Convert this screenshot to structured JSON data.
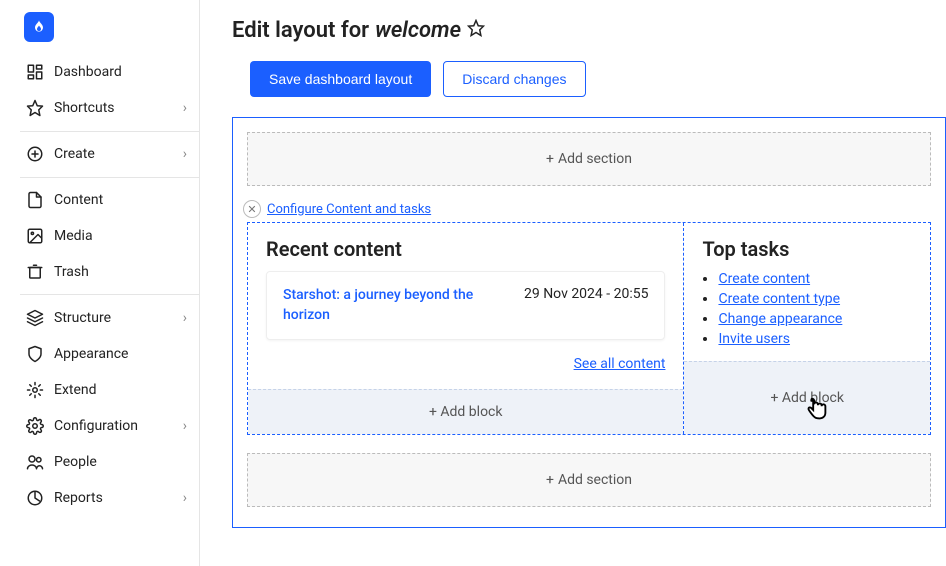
{
  "sidebar": {
    "items": [
      {
        "label": "Dashboard",
        "icon": "dashboard",
        "chevron": false
      },
      {
        "label": "Shortcuts",
        "icon": "star",
        "chevron": true,
        "divAfter": true
      },
      {
        "label": "Create",
        "icon": "plus-circle",
        "chevron": true,
        "divAfter": true
      },
      {
        "label": "Content",
        "icon": "file",
        "chevron": false
      },
      {
        "label": "Media",
        "icon": "image",
        "chevron": false
      },
      {
        "label": "Trash",
        "icon": "trash",
        "chevron": false
      },
      {
        "label": "Structure",
        "icon": "layers",
        "chevron": true,
        "divBefore": true
      },
      {
        "label": "Appearance",
        "icon": "shield",
        "chevron": false
      },
      {
        "label": "Extend",
        "icon": "puzzle",
        "chevron": false
      },
      {
        "label": "Configuration",
        "icon": "gear",
        "chevron": true
      },
      {
        "label": "People",
        "icon": "people",
        "chevron": false
      },
      {
        "label": "Reports",
        "icon": "chart",
        "chevron": true
      }
    ]
  },
  "page": {
    "title_prefix": "Edit layout for ",
    "title_subject": "welcome"
  },
  "toolbar": {
    "save": "Save dashboard layout",
    "discard": "Discard changes"
  },
  "layout": {
    "add_section": "Add section",
    "configure": "Configure Content and tasks",
    "add_block": "Add block",
    "recent": {
      "heading": "Recent content",
      "item_title": "Starshot: a journey beyond the horizon",
      "item_date": "29 Nov 2024 - 20:55",
      "see_all": "See all content"
    },
    "tasks": {
      "heading": "Top tasks",
      "items": [
        "Create content",
        "Create content type",
        "Change appearance",
        "Invite users"
      ]
    }
  }
}
